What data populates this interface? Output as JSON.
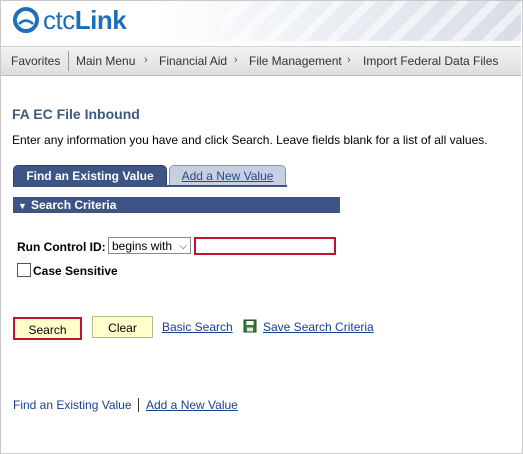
{
  "brand": {
    "logo_part1": "ctc",
    "logo_part2": "Link"
  },
  "nav": {
    "items": [
      "Favorites",
      "Main Menu",
      "Financial Aid",
      "File Management",
      "Import Federal Data Files"
    ]
  },
  "page": {
    "title": "FA EC File Inbound",
    "instructions": "Enter any information you have and click Search. Leave fields blank for a list of all values."
  },
  "tabs": {
    "active": "Find an Existing Value",
    "inactive": "Add a New Value"
  },
  "criteria": {
    "header": "Search Criteria",
    "run_control_label": "Run Control ID:",
    "operator_value": "begins with",
    "run_control_value": "",
    "case_sensitive_label": "Case Sensitive",
    "case_sensitive_checked": false
  },
  "actions": {
    "search": "Search",
    "clear": "Clear",
    "basic_search": "Basic Search",
    "save_search": "Save Search Criteria"
  },
  "footer": {
    "find_link": "Find an Existing Value",
    "add_link": "Add a New Value"
  },
  "colors": {
    "brand_blue": "#1c6fb8",
    "tab_active": "#3d5585",
    "button_yellow": "#ffffcc",
    "focus_red": "#c8102e"
  }
}
